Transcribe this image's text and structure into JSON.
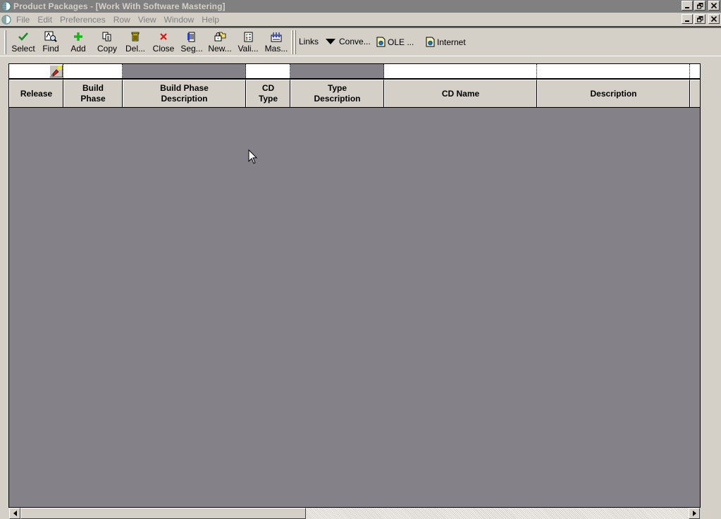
{
  "window": {
    "title": "Product Packages - [Work With Software Mastering]"
  },
  "menubar": {
    "items": [
      "File",
      "Edit",
      "Preferences",
      "Row",
      "View",
      "Window",
      "Help"
    ]
  },
  "toolbar": {
    "buttons": [
      {
        "label": "Select",
        "accel": "S",
        "icon": "checkmark-icon"
      },
      {
        "label": "Find",
        "accel": "i",
        "icon": "find-icon"
      },
      {
        "label": "Add",
        "accel": "A",
        "icon": "plus-icon"
      },
      {
        "label": "Copy",
        "accel": "y",
        "icon": "copy-icon"
      },
      {
        "label": "Del...",
        "accel": "D",
        "icon": "trash-icon"
      },
      {
        "label": "Close",
        "accel": "C",
        "icon": "close-x-icon"
      },
      {
        "label": "Seg...",
        "accel": "g",
        "icon": "segment-icon"
      },
      {
        "label": "New...",
        "accel": "N",
        "icon": "new-folder-icon"
      },
      {
        "label": "Vali...",
        "accel": "V",
        "icon": "validate-icon"
      },
      {
        "label": "Mas...",
        "accel": "",
        "icon": "master-icon"
      }
    ],
    "links_label": "Links",
    "links": [
      {
        "label": "Conve...",
        "icon": "dropdown-arrow-icon"
      },
      {
        "label": "OLE ...",
        "icon": "ole-document-icon"
      },
      {
        "label": "Internet",
        "icon": "internet-document-icon"
      }
    ]
  },
  "grid": {
    "columns": [
      {
        "header_line1": "Release",
        "header_line2": "",
        "qbe_editable": true
      },
      {
        "header_line1": "Build",
        "header_line2": "Phase",
        "qbe_editable": true
      },
      {
        "header_line1": "Build Phase",
        "header_line2": "Description",
        "qbe_editable": false
      },
      {
        "header_line1": "CD",
        "header_line2": "Type",
        "qbe_editable": true
      },
      {
        "header_line1": "Type",
        "header_line2": "Description",
        "qbe_editable": false
      },
      {
        "header_line1": "CD Name",
        "header_line2": "",
        "qbe_editable": true
      },
      {
        "header_line1": "Description",
        "header_line2": "",
        "qbe_editable": true
      }
    ],
    "rows": [],
    "colors": {
      "grid_background": "#848288",
      "header_background": "#d4d0c8",
      "qbe_background": "#ffffff"
    }
  },
  "colors": {
    "window_chrome": "#d4d0c8",
    "title_bar_inactive": "#808080",
    "title_text": "#d4d0c8"
  }
}
